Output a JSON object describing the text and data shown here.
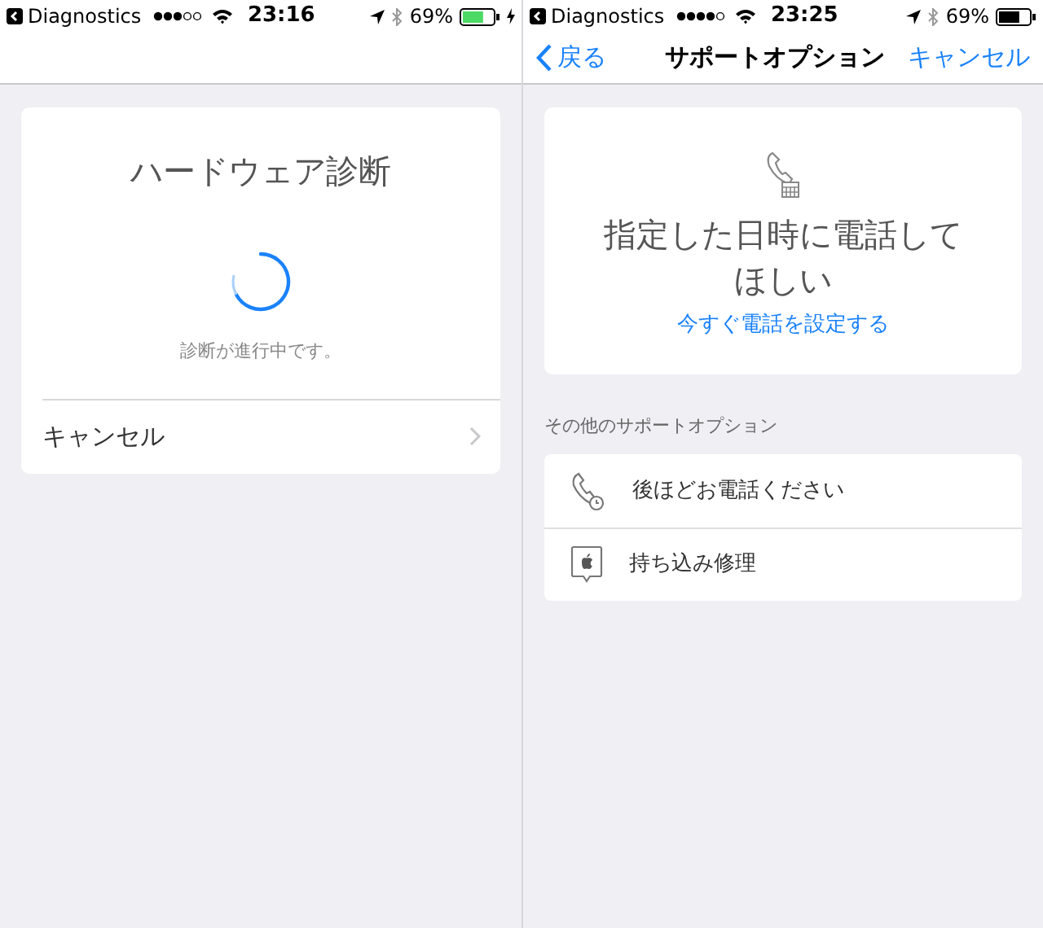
{
  "screens": [
    {
      "status_bar": {
        "back_app": "Diagnostics",
        "time": "23:16",
        "battery": "69%",
        "charging": true
      },
      "diagnostic_card": {
        "title": "ハードウェア診断",
        "status": "診断が進行中です。",
        "cancel": "キャンセル"
      }
    },
    {
      "status_bar": {
        "back_app": "Diagnostics",
        "time": "23:25",
        "battery": "69%",
        "charging": false
      },
      "nav_bar": {
        "back": "戻る",
        "title": "サポートオプション",
        "action": "キャンセル"
      },
      "featured_card": {
        "headline": "指定した日時に電話してほしい",
        "link": "今すぐ電話を設定する"
      },
      "section_header": "その他のサポートオプション",
      "options": [
        {
          "kind": "callback",
          "label": "後ほどお電話ください"
        },
        {
          "kind": "store",
          "label": "持ち込み修理"
        }
      ]
    }
  ]
}
